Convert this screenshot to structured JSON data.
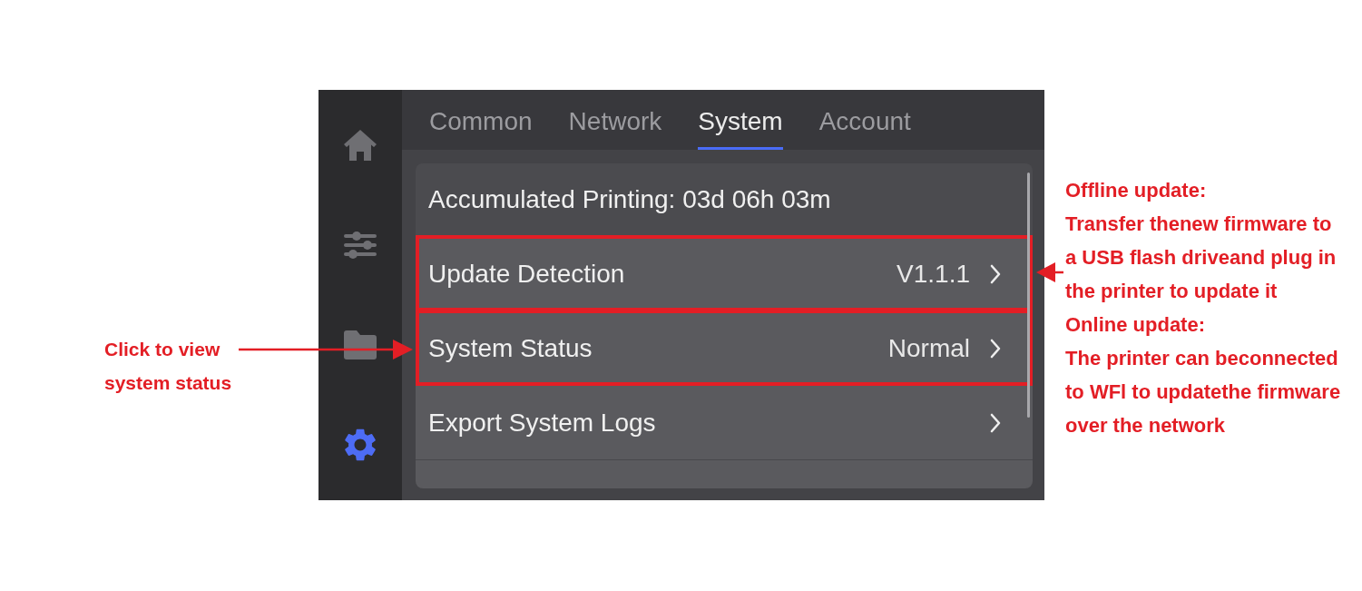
{
  "sidebar": {
    "items": [
      {
        "selected": false
      },
      {
        "selected": false
      },
      {
        "selected": false
      },
      {
        "selected": true
      }
    ]
  },
  "tabs": [
    {
      "label": "Common",
      "selected": false
    },
    {
      "label": "Network",
      "selected": false
    },
    {
      "label": "System",
      "selected": true
    },
    {
      "label": "Account",
      "selected": false
    }
  ],
  "rows": [
    {
      "kind": "info",
      "label": "Accumulated Printing: 03d 06h 03m",
      "highlighted": false
    },
    {
      "kind": "link",
      "label": "Update Detection",
      "value": "V1.1.1",
      "highlighted": true
    },
    {
      "kind": "link",
      "label": "System Status",
      "value": "Normal",
      "highlighted": true
    },
    {
      "kind": "link",
      "label": "Export System Logs",
      "highlighted": false
    },
    {
      "kind": "partial",
      "highlighted": false
    }
  ],
  "annotations": {
    "left": "Click to view system status",
    "right": [
      "Offline update:",
      "Transfer thenew firmware to a USB flash driveand plug in the printer to update it",
      "Online update:",
      "The printer can beconnected to WFl to updatethe firmware over the network"
    ]
  }
}
